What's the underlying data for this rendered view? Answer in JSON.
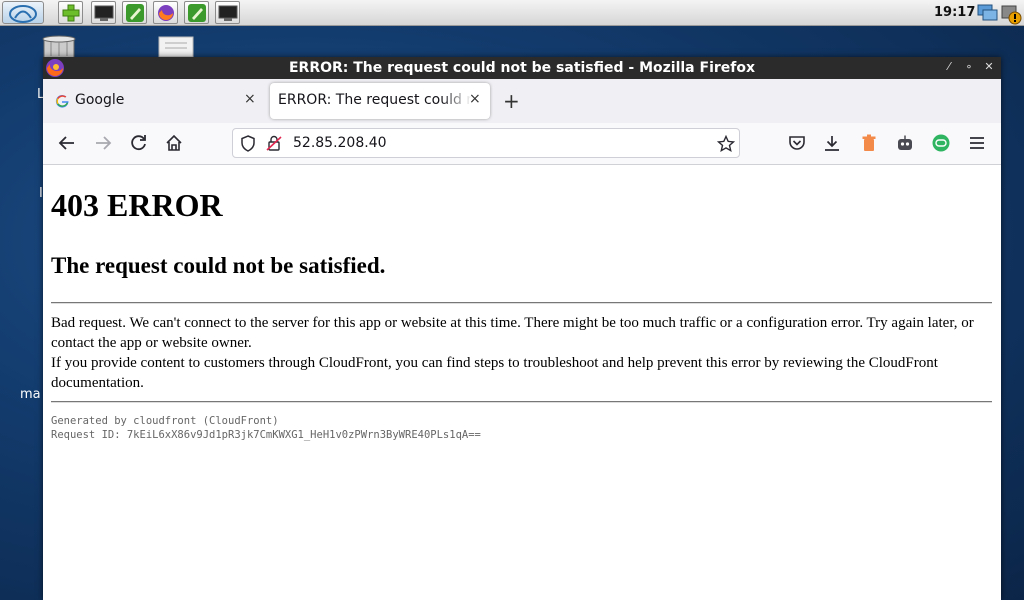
{
  "taskbar": {
    "clock": "19:17",
    "launchers": [
      "app-menu-icon",
      "add-icon",
      "terminal-icon",
      "editor-icon",
      "firefox-icon",
      "editor-icon",
      "terminal-icon"
    ]
  },
  "desktop": {
    "labels": [
      "L",
      "I",
      "ma"
    ]
  },
  "window": {
    "title": "ERROR: The request could not be satisfied - Mozilla Firefox"
  },
  "tabs": [
    {
      "label": "Google",
      "close": "×"
    },
    {
      "label": "ERROR: The request could not be satisfied",
      "close": "×"
    }
  ],
  "newtab_label": "+",
  "url": "52.85.208.40",
  "page": {
    "heading": "403 ERROR",
    "subheading": "The request could not be satisfied.",
    "para1": "Bad request. We can't connect to the server for this app or website at this time. There might be too much traffic or a configuration error. Try again later, or contact the app or website owner.",
    "para2": "If you provide content to customers through CloudFront, you can find steps to troubleshoot and help prevent this error by reviewing the CloudFront documentation.",
    "generated": "Generated by cloudfront (CloudFront)",
    "request_id": "Request ID: 7kEiL6xX86v9Jd1pR3jk7CmKWXG1_HeH1v0zPWrn3ByWRE40PLs1qA=="
  },
  "colors": {
    "desktop_bg": "#123a6b",
    "titlebar": "#2b2b2b",
    "tabstrip": "#f0f0f4"
  }
}
